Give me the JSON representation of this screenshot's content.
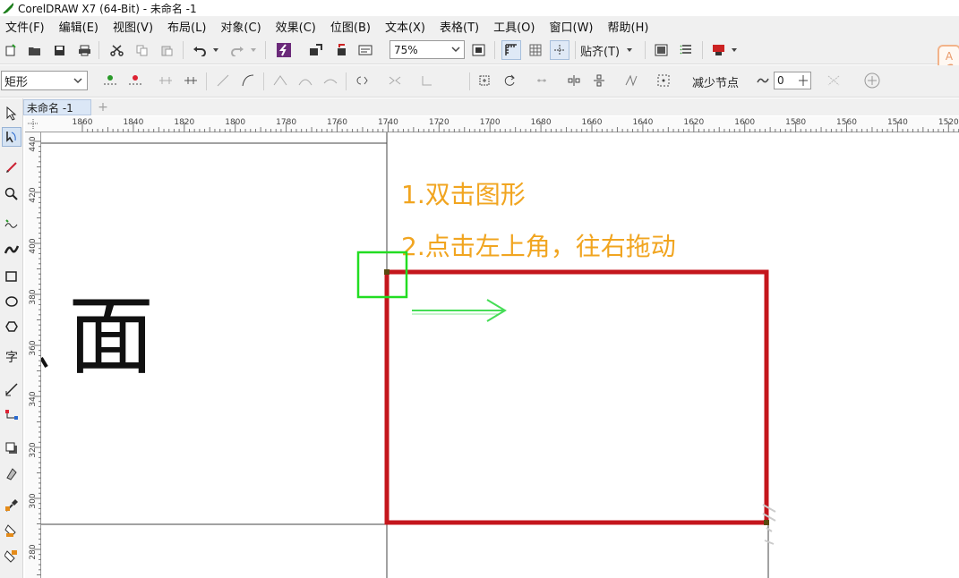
{
  "window": {
    "title": "CorelDRAW X7 (64-Bit) - 未命名 -1"
  },
  "menu": [
    "文件(F)",
    "编辑(E)",
    "视图(V)",
    "布局(L)",
    "对象(C)",
    "效果(C)",
    "位图(B)",
    "文本(X)",
    "表格(T)",
    "工具(O)",
    "窗口(W)",
    "帮助(H)"
  ],
  "toolbar": {
    "zoom_value": "75%",
    "snap_label": "贴齐(T)"
  },
  "propbar": {
    "shape_type": "矩形",
    "reduce_nodes_label": "减少节点",
    "curve_smooth_value": "0"
  },
  "document": {
    "tab_label": "未命名 -1"
  },
  "ruler": {
    "horizontal_ticks": [
      "1860",
      "1840",
      "1820",
      "1800",
      "1780",
      "1760",
      "1740",
      "1720",
      "1700",
      "1680",
      "1660",
      "1640",
      "1620",
      "1600",
      "1580",
      "1560",
      "1540",
      "1520"
    ],
    "vertical_ticks": [
      "440",
      "420",
      "400",
      "380",
      "360",
      "340",
      "320",
      "300",
      "280"
    ]
  },
  "canvas": {
    "instruction_1": "1.双击图形",
    "instruction_2": "2.点击左上角，往右拖动",
    "partial_character": "面"
  },
  "colors": {
    "accent_orange": "#f1a520",
    "rect_red": "#c4161c",
    "highlight_green": "#22dd22"
  }
}
